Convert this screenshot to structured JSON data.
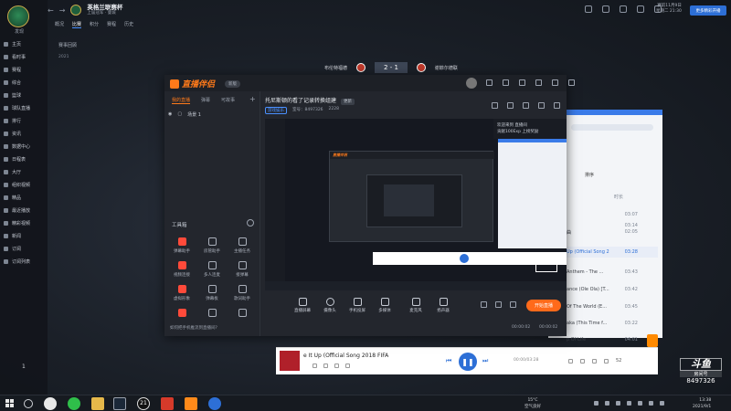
{
  "bg_app": {
    "logo_caption": "发现",
    "nav_title": "英格兰联赛杯",
    "nav_subtitle": "上届冠军 · 曼城",
    "tabs": [
      "概况",
      "比赛",
      "积分",
      "赛程",
      "历史"
    ],
    "section": "赛事回顾",
    "section_sub": "2021",
    "sidebar_items": [
      "主页",
      "看时事",
      "赛程",
      "综合",
      "篮球",
      "球队直播",
      "排行",
      "资讯",
      "数据中心",
      "日程表",
      "大厅",
      "组织视频",
      "精品",
      "最近播放",
      "精彩视频",
      "新闻",
      "订阅",
      "订阅列表"
    ],
    "time_line1": "赛前11月9日",
    "time_line2": "星期二 21:30",
    "login_button": "更多精彩开播",
    "home_team": "布伦特福德",
    "score": "2 - 1",
    "away_team": "谢菲尔德联",
    "desk_number": "1"
  },
  "music": {
    "sort_label": "排序",
    "col_time": "时长",
    "rows": [
      {
        "title": "",
        "time": "03:07"
      },
      {
        "title": "",
        "time": "03:14"
      },
      {
        "title": "曲",
        "time": "02:05"
      },
      {
        "title": "Up (Official Song 2",
        "time": "03:28"
      },
      {
        "title": "Anthem - The ...",
        "time": "03:43"
      },
      {
        "title": "ance (Ole Ola) [T...",
        "time": "03:42"
      },
      {
        "title": "Of The World (E...",
        "time": "03:45"
      },
      {
        "title": "aka (This Time f...",
        "time": "03:22"
      },
      {
        "title": "p Of Life",
        "time": "04:01"
      }
    ]
  },
  "player": {
    "song": "e It Up (Official Song 2018 FIFA",
    "time": "00:00/03:28",
    "count": "52"
  },
  "live_app": {
    "name": "直播伴侣",
    "version": "新版",
    "left_tabs": [
      "我的直播",
      "弹幕",
      "可故事"
    ],
    "scene_label": "场景 1",
    "tools_label": "工具箱",
    "tools": [
      "弹幕助手",
      "房管助手",
      "主播任务",
      "视频连接",
      "多人连麦",
      "接弹幕",
      "虚拟形象",
      "弹幕板",
      "歌词助手",
      "更多",
      "",
      ""
    ],
    "tip": "如何把手机推流到直播间?",
    "room_title": "托尼斯顿的看了记录转换组建",
    "room_tag": "更新",
    "room_category": "游戏娱乐",
    "room_id": "室号：8497326",
    "room_heat": "2228",
    "controls": [
      "直播屏幕",
      "摄像头",
      "手机投屏",
      "多媒体",
      "麦克风",
      "扬声器"
    ],
    "start_button": "开始直播",
    "status_left": "",
    "status_time1": "00:00:02",
    "status_time2": "00:00:02"
  },
  "preview": {
    "chat_line1": "欢迎来到 直播间",
    "chat_line2": "贡献100Exp 上榜奖励",
    "watermark": "斗鱼"
  },
  "watermark": {
    "logo": "斗鱼",
    "room_label": "房间号",
    "room_number": "8497326"
  },
  "taskbar": {
    "temperature": "15°C",
    "weather": "空气良好",
    "time": "13:38",
    "date": "2021/9/1"
  }
}
